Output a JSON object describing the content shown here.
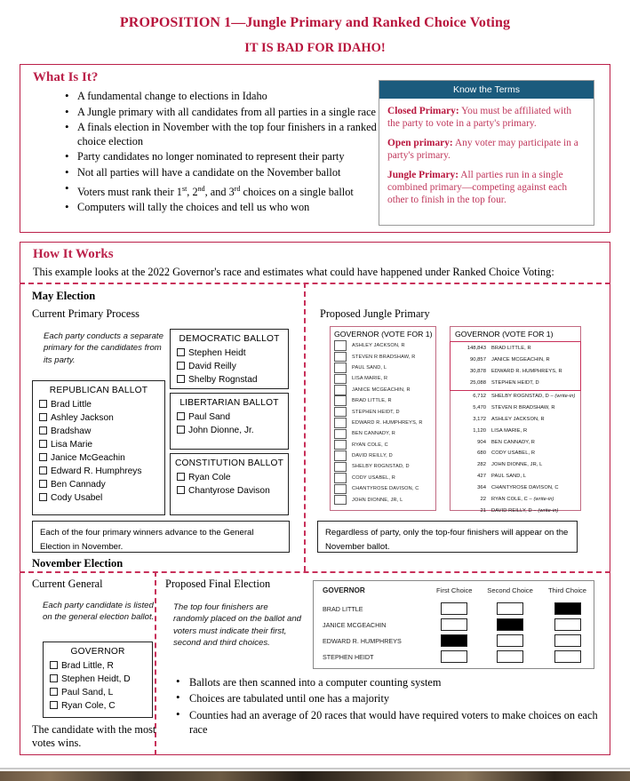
{
  "doc": {
    "title": "PROPOSITION 1—Jungle Primary and Ranked Choice Voting",
    "subtitle": "IT IS BAD FOR IDAHO!",
    "accent_red": "#bb2049",
    "accent_teal": "#1b5b7d"
  },
  "what_is_it": {
    "heading": "What Is It?",
    "bullets": [
      "A fundamental change to elections in Idaho",
      "A Jungle primary with all candidates from all parties in a single race",
      "A finals election in November with the top four finishers in a ranked choice election",
      "Party candidates no longer nominated to represent their party",
      "Not all parties will have a candidate on the November ballot",
      "Voters must rank their 1st, 2nd, and 3rd choices on a single ballot",
      "Computers will tally the choices and tell us who won"
    ],
    "bullet_ranked_html": "Voters must rank their 1<sup>st</sup>, 2<sup>nd</sup>, and 3<sup>rd</sup> choices on a single ballot"
  },
  "know_the_terms": {
    "header": "Know the Terms",
    "entries": [
      {
        "term": "Closed Primary:",
        "definition": "You must be affiliated with the party to vote in a party's primary."
      },
      {
        "term": "Open primary:",
        "definition": "Any voter may participate in a party's primary."
      },
      {
        "term": "Jungle Primary:",
        "definition": "All parties run in a single combined primary—competing against each other to finish in the top four."
      }
    ]
  },
  "how_it_works": {
    "heading": "How It Works",
    "intro": "This example looks at the 2022 Governor's race and estimates what could have happened under Ranked Choice Voting:",
    "may_election": {
      "label": "May Election",
      "left_col_head": "Current Primary Process",
      "right_col_head": "Proposed Jungle Primary",
      "left_note": "Each party conducts a separate primary for the candidates from its party.",
      "left_footer": "Each of the four primary winners advance to the General Election in November.",
      "right_footer": "Regardless of party, only the top-four finishers will appear on the November ballot.",
      "party_ballots": [
        {
          "title": "REPUBLICAN BALLOT",
          "candidates": [
            "Brad Little",
            "Ashley Jackson",
            "Bradshaw",
            "Lisa Marie",
            "Janice McGeachin",
            "Edward R. Humphreys",
            "Ben Cannady",
            "Cody Usabel"
          ]
        },
        {
          "title": "DEMOCRATIC BALLOT",
          "candidates": [
            "Stephen Heidt",
            "David Reilly",
            "Shelby Rognstad"
          ]
        },
        {
          "title": "LIBERTARIAN BALLOT",
          "candidates": [
            "Paul Sand",
            "John Dionne, Jr."
          ]
        },
        {
          "title": "CONSTITUTION BALLOT",
          "candidates": [
            "Ryan Cole",
            "Chantyrose Davison"
          ]
        }
      ],
      "jungle_ballot": {
        "title": "GOVERNOR (VOTE FOR 1)",
        "candidates": [
          "ASHLEY JACKSON, R",
          "STEVEN R BRADSHAW, R",
          "PAUL SAND, L",
          "LISA MARIE, R",
          "JANICE MCGEACHIN, R",
          "BRAD LITTLE, R",
          "STEPHEN HEIDT, D",
          "EDWARD R. HUMPHREYS, R",
          "BEN CANNADY, R",
          "RYAN COLE, C",
          "DAVID REILLY, D",
          "SHELBY ROGNSTAD, D",
          "CODY USABEL, R",
          "CHANTYROSE DAVISON, C",
          "JOHN DIONNE, JR, L"
        ]
      },
      "results": {
        "title": "GOVERNOR (VOTE FOR 1)",
        "top_four": [
          {
            "votes": "148,843",
            "name": "BRAD LITTLE, R",
            "note": ""
          },
          {
            "votes": "90,857",
            "name": "JANICE MCGEACHIN, R",
            "note": ""
          },
          {
            "votes": "30,878",
            "name": "EDWARD R. HUMPHREYS, R",
            "note": ""
          },
          {
            "votes": "25,088",
            "name": "STEPHEN HEIDT, D",
            "note": ""
          }
        ],
        "rest": [
          {
            "votes": "6,712",
            "name": "SHELBY ROGNSTAD, D – ",
            "note": "(write-in)"
          },
          {
            "votes": "5,470",
            "name": "STEVEN R BRADSHAW, R",
            "note": ""
          },
          {
            "votes": "3,172",
            "name": "ASHLEY JACKSON, R",
            "note": ""
          },
          {
            "votes": "1,120",
            "name": "LISA MARIE, R",
            "note": ""
          },
          {
            "votes": "904",
            "name": "BEN CANNADY, R",
            "note": ""
          },
          {
            "votes": "680",
            "name": "CODY USABEL, R",
            "note": ""
          },
          {
            "votes": "282",
            "name": "JOHN DIONNE, JR, L",
            "note": ""
          },
          {
            "votes": "427",
            "name": "PAUL SAND, L",
            "note": ""
          },
          {
            "votes": "364",
            "name": "CHANTYROSE DAVISON, C",
            "note": ""
          },
          {
            "votes": "22",
            "name": "RYAN COLE, C – ",
            "note": "(write-in)"
          },
          {
            "votes": "21",
            "name": "DAVID REILLY, D – ",
            "note": "(write-in)"
          }
        ]
      }
    },
    "november_election": {
      "label": "November Election",
      "left_col_head": "Current General",
      "right_col_head": "Proposed Final Election",
      "left_note": "Each party candidate is listed on the general election ballot.",
      "right_note": "The top four finishers are randomly placed on the ballot and voters must indicate their first, second and third choices.",
      "general_ballot": {
        "title": "GOVERNOR",
        "candidates": [
          "Brad Little, R",
          "Stephen Heidt, D",
          "Paul Sand, L",
          "Ryan Cole, C"
        ]
      },
      "left_footer": "The candidate with the most votes wins.",
      "rcv_ballot": {
        "title": "GOVERNOR",
        "columns": [
          "First Choice",
          "Second Choice",
          "Third Choice"
        ],
        "rows": [
          {
            "name": "BRAD LITTLE",
            "marks": [
              false,
              false,
              true
            ]
          },
          {
            "name": "JANICE MCGEACHIN",
            "marks": [
              false,
              true,
              false
            ]
          },
          {
            "name": "EDWARD R. HUMPHREYS",
            "marks": [
              true,
              false,
              false
            ]
          },
          {
            "name": "STEPHEN HEIDT",
            "marks": [
              false,
              false,
              false
            ]
          }
        ]
      },
      "bullets": [
        "Ballots are then scanned into a computer counting system",
        "Choices are tabulated until one has a majority",
        "Counties had an average of 20 races that would have required voters to make choices on each race"
      ]
    }
  }
}
